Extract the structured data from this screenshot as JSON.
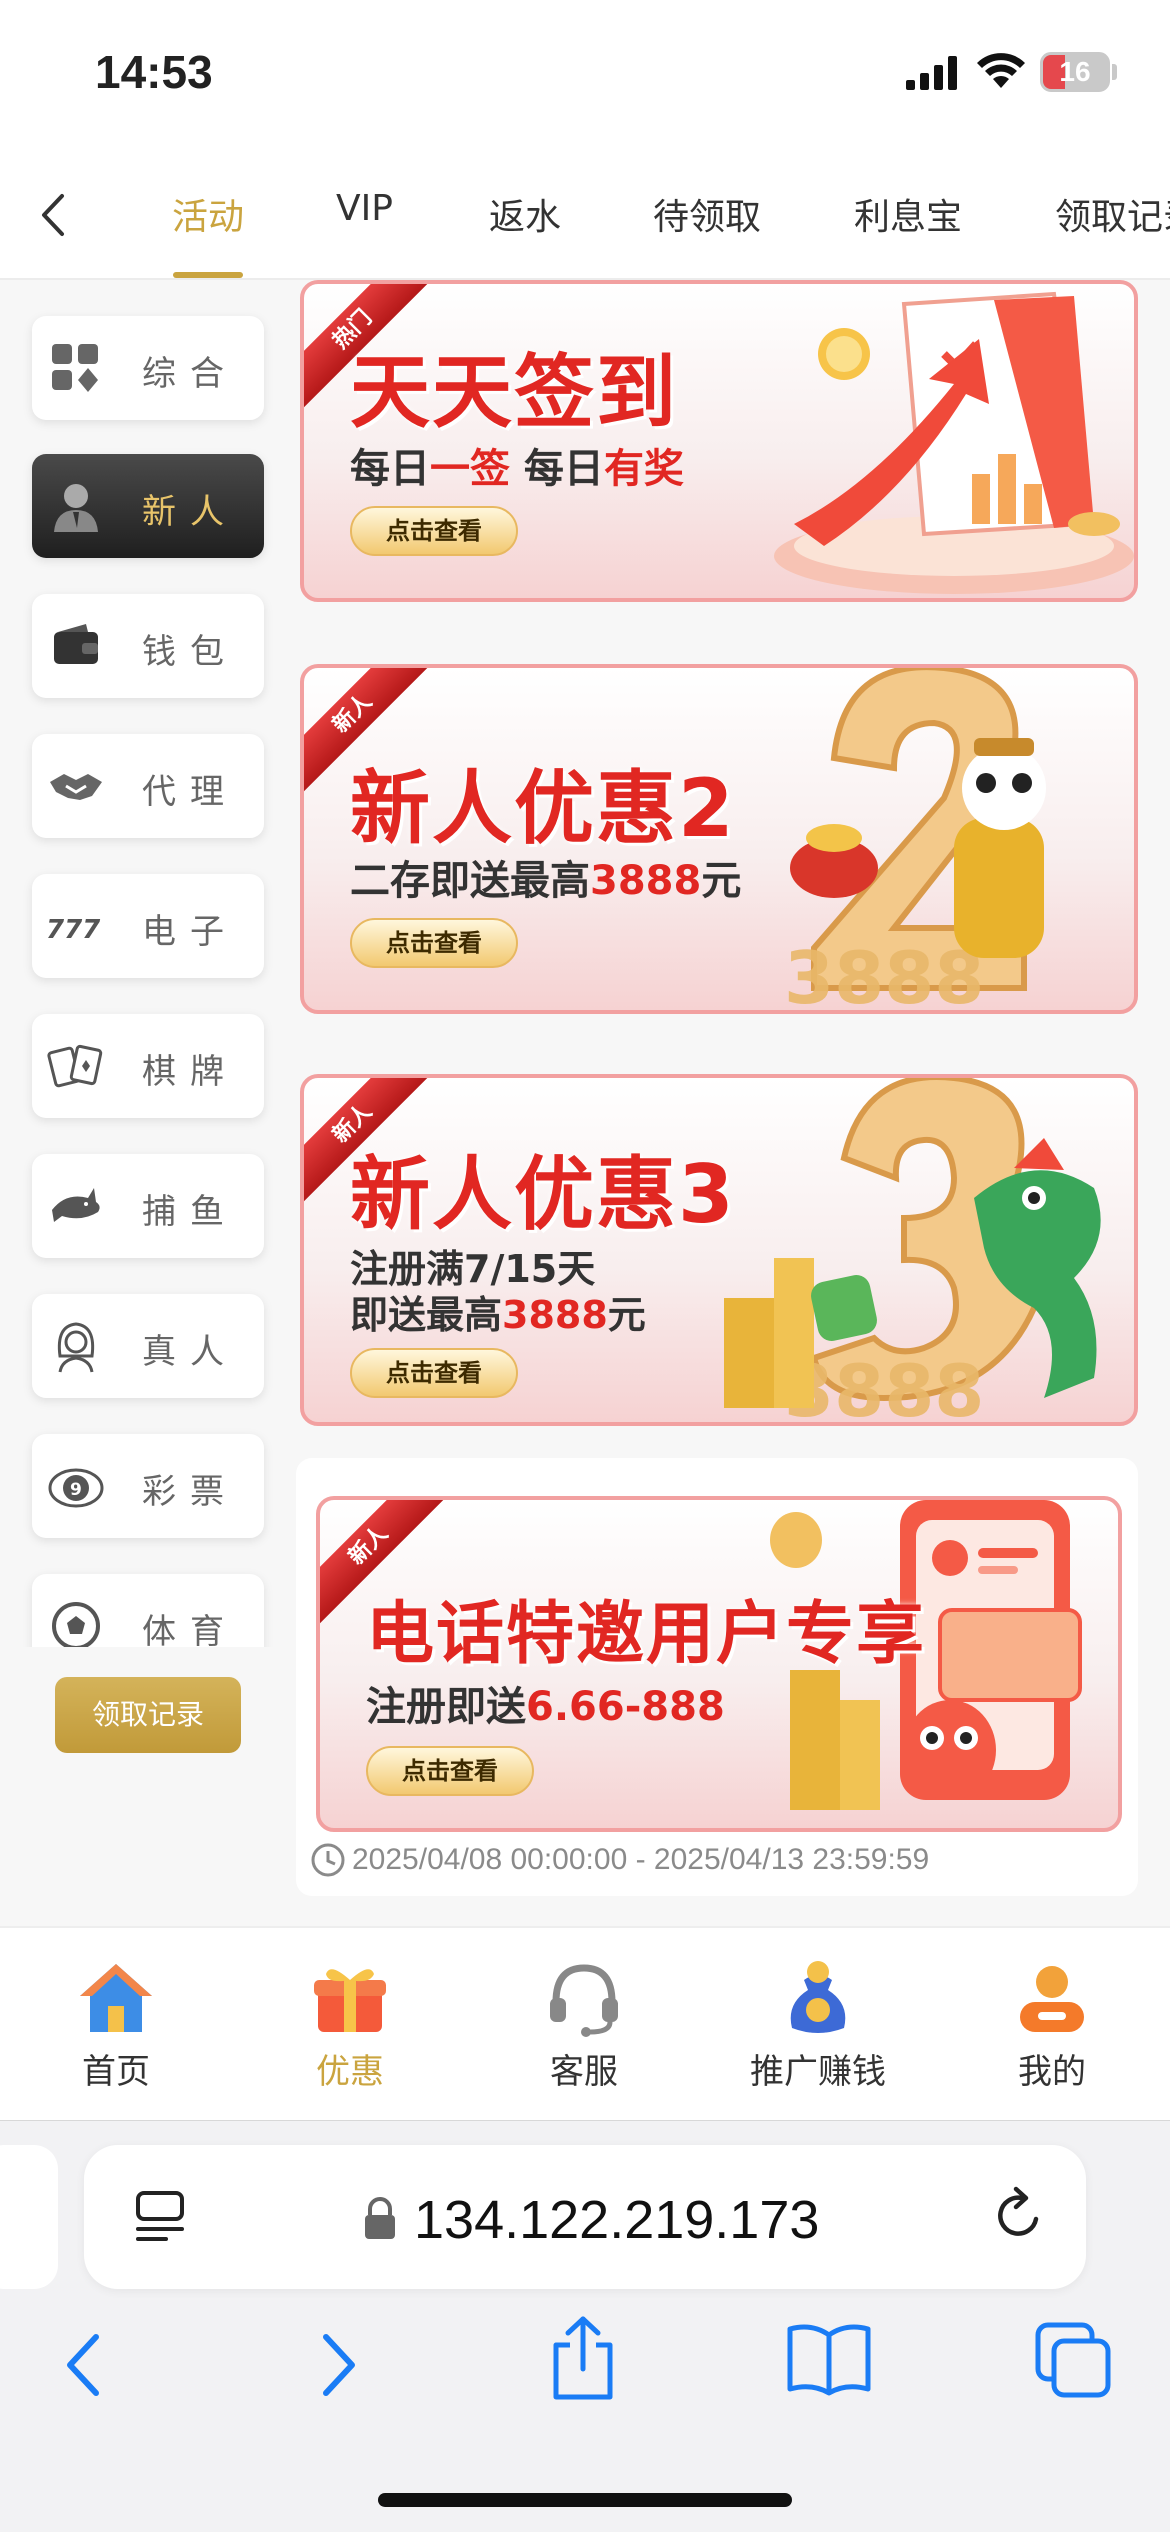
{
  "status_bar": {
    "time": "14:53",
    "battery": "16"
  },
  "top_tabs": {
    "back_icon": "chevron-left-icon",
    "items": [
      {
        "label": "活动",
        "active": true
      },
      {
        "label": "VIP"
      },
      {
        "label": "返水"
      },
      {
        "label": "待领取"
      },
      {
        "label": "利息宝"
      },
      {
        "label": "领取记录"
      }
    ]
  },
  "sidebar": {
    "items": [
      {
        "label": "综合",
        "icon": "grid-icon"
      },
      {
        "label": "新人",
        "icon": "person-icon",
        "active": true
      },
      {
        "label": "钱包",
        "icon": "wallet-icon"
      },
      {
        "label": "代理",
        "icon": "handshake-icon"
      },
      {
        "label": "电子",
        "icon": "slot-777-icon"
      },
      {
        "label": "棋牌",
        "icon": "cards-icon"
      },
      {
        "label": "捕鱼",
        "icon": "shark-icon"
      },
      {
        "label": "真人",
        "icon": "woman-icon"
      },
      {
        "label": "彩票",
        "icon": "lottery-ball-icon"
      },
      {
        "label": "体育",
        "icon": "soccer-ball-icon"
      }
    ],
    "claim_button": "领取记录"
  },
  "banners": [
    {
      "ribbon": "热门",
      "title": "天天签到",
      "subtitle_parts": [
        "每日",
        "一签",
        " 每日",
        "有奖"
      ],
      "cta": "点击查看"
    },
    {
      "ribbon": "新人",
      "title": "新人优惠2",
      "subtitle_prefix": "二存即送最高",
      "subtitle_highlight": "3888",
      "subtitle_suffix": "元",
      "cta": "点击查看",
      "deco_number": "3888"
    },
    {
      "ribbon": "新人",
      "title": "新人优惠3",
      "subtitle_line1": "注册满7/15天",
      "subtitle_prefix": "即送最高",
      "subtitle_highlight": "3888",
      "subtitle_suffix": "元",
      "cta": "点击查看",
      "deco_number": "3888"
    },
    {
      "ribbon": "新人",
      "title": "电话特邀用户专享",
      "subtitle_prefix": "注册即送",
      "subtitle_highlight": "6.66-888",
      "cta": "点击查看",
      "time_range": "2025/04/08 00:00:00 - 2025/04/13 23:59:59"
    }
  ],
  "bottom_nav": {
    "items": [
      {
        "label": "首页",
        "icon": "house-icon"
      },
      {
        "label": "优惠",
        "icon": "gift-icon",
        "active": true
      },
      {
        "label": "客服",
        "icon": "headset-icon"
      },
      {
        "label": "推广赚钱",
        "icon": "money-bag-icon"
      },
      {
        "label": "我的",
        "icon": "profile-icon"
      }
    ]
  },
  "browser": {
    "url": "134.122.219.173"
  },
  "colors": {
    "accent_gold": "#caa43f",
    "promo_red": "#e12722"
  }
}
